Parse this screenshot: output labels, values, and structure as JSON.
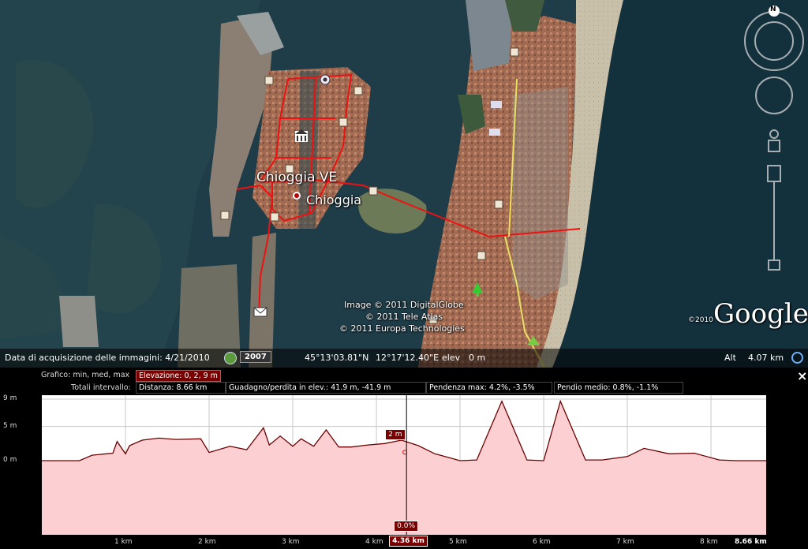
{
  "map": {
    "place_primary": "Chioggia VE",
    "place_secondary": "Chioggia",
    "copyright": [
      "Image © 2011 DigitalGlobe",
      "© 2011 Tele Atlas",
      "© 2011 Europa Technologies"
    ],
    "logo_year": "©2010",
    "logo_text": "Google",
    "compass_north": "N"
  },
  "status": {
    "imagery_date": "Data di acquisizione delle immagini: 4/21/2010",
    "year": "2007",
    "lat": "45°13'03.81\"N",
    "lon": "12°17'12.40\"E",
    "elev_label": "elev",
    "elev_value": "0 m",
    "alt_label": "Alt",
    "alt_value": "4.07 km"
  },
  "profile": {
    "graph_label": "Grafico: min, med, max",
    "elev_summary": "Elevazione: 0, 2, 9 m",
    "totals_label": "Totali intervallo:",
    "distance": "Distanza: 8.66 km",
    "gain_loss": "Guadagno/perdita in elev.: 41.9 m, -41.9 m",
    "max_slope": "Pendenza max: 4.2%, -3.5%",
    "avg_slope": "Pendio medio: 0.8%, -1.1%",
    "close_label": "×",
    "cursor_elev": "2 m",
    "cursor_slope": "0.0%",
    "cursor_dist": "4.36 km",
    "colors": {
      "fill": "#fcd0d2",
      "line": "#6b0000",
      "tag": "#7a0000"
    }
  },
  "chart_data": {
    "type": "area",
    "xlabel": "",
    "ylabel": "",
    "xlim": [
      0,
      8.66
    ],
    "ylim": [
      0,
      9
    ],
    "x_ticks": [
      "1 km",
      "2 km",
      "3 km",
      "4 km",
      "5 km",
      "6 km",
      "7 km",
      "8 km",
      "8.66 km"
    ],
    "y_ticks": [
      "9 m",
      "5 m",
      "0 m"
    ],
    "series": [
      {
        "x": [
          0,
          0.45,
          0.6,
          0.85,
          0.9,
          1.0,
          1.05,
          1.2,
          1.4,
          1.6,
          1.9,
          2.0,
          2.25,
          2.45,
          2.65,
          2.72,
          2.85,
          3.0,
          3.1,
          3.25,
          3.4,
          3.55,
          3.7,
          3.9,
          4.1,
          4.3,
          4.5,
          4.7,
          5.0,
          5.2,
          5.5,
          5.8,
          6.0,
          6.2,
          6.5,
          6.7,
          7.0,
          7.2,
          7.5,
          7.8,
          8.1,
          8.3,
          8.66
        ],
        "y": [
          0,
          0,
          0.8,
          1.1,
          2.8,
          1.0,
          2.2,
          3.0,
          3.3,
          3.1,
          3.2,
          1.2,
          2.1,
          1.6,
          4.8,
          2.3,
          3.6,
          2.1,
          3.2,
          2.1,
          4.5,
          2.0,
          2.0,
          2.3,
          2.5,
          3.0,
          2.2,
          1.0,
          0,
          0.1,
          8.7,
          0.1,
          0,
          8.7,
          0.1,
          0.1,
          0.6,
          1.8,
          1.0,
          1.1,
          0.1,
          0,
          0
        ]
      }
    ]
  }
}
